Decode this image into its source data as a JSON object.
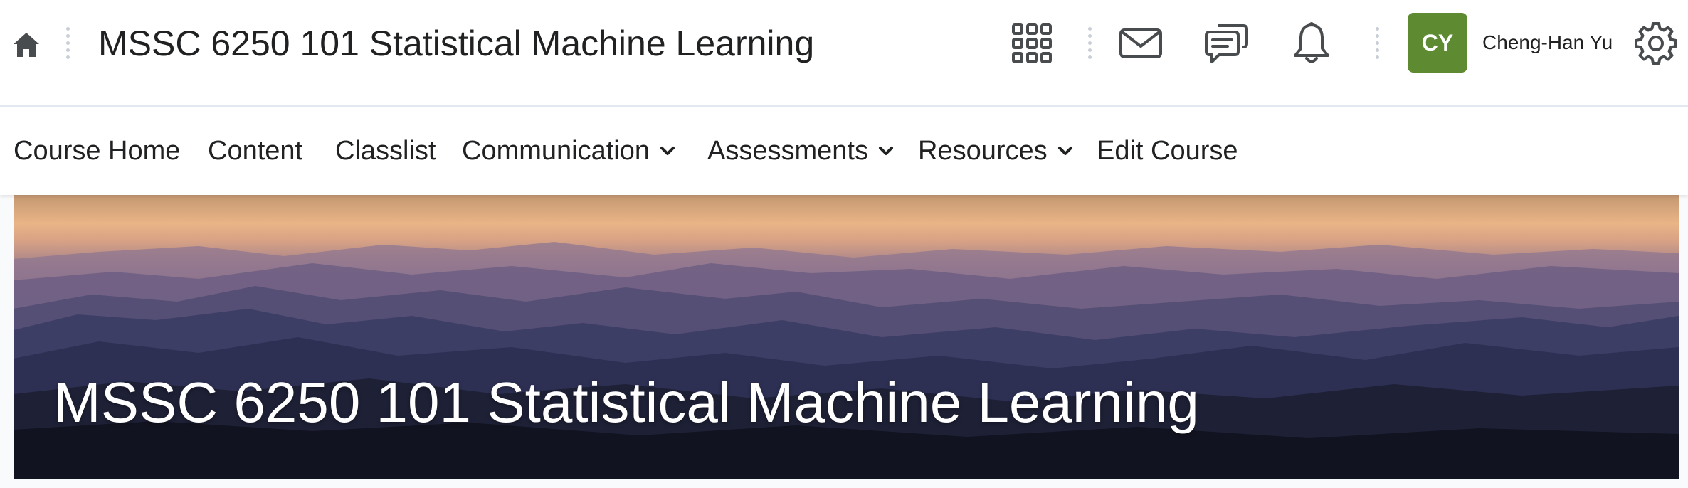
{
  "header": {
    "course_title": "MSSC 6250 101 Statistical Machine Learning",
    "icons": [
      "home-icon",
      "waffle-grid-icon",
      "mail-icon",
      "chat-icon",
      "bell-icon",
      "gear-icon"
    ],
    "user": {
      "initials": "CY",
      "name": "Cheng-Han Yu",
      "avatar_color": "#5e8a31"
    }
  },
  "nav": {
    "items": [
      {
        "label": "Course Home",
        "has_menu": false
      },
      {
        "label": "Content",
        "has_menu": false
      },
      {
        "label": "Classlist",
        "has_menu": false
      },
      {
        "label": "Communication",
        "has_menu": true
      },
      {
        "label": "Assessments",
        "has_menu": true
      },
      {
        "label": "Resources",
        "has_menu": true
      },
      {
        "label": "Edit Course",
        "has_menu": false
      }
    ]
  },
  "banner": {
    "title": "MSSC 6250 101 Statistical Machine Learning",
    "image": "mountain-ranges-at-dusk"
  }
}
